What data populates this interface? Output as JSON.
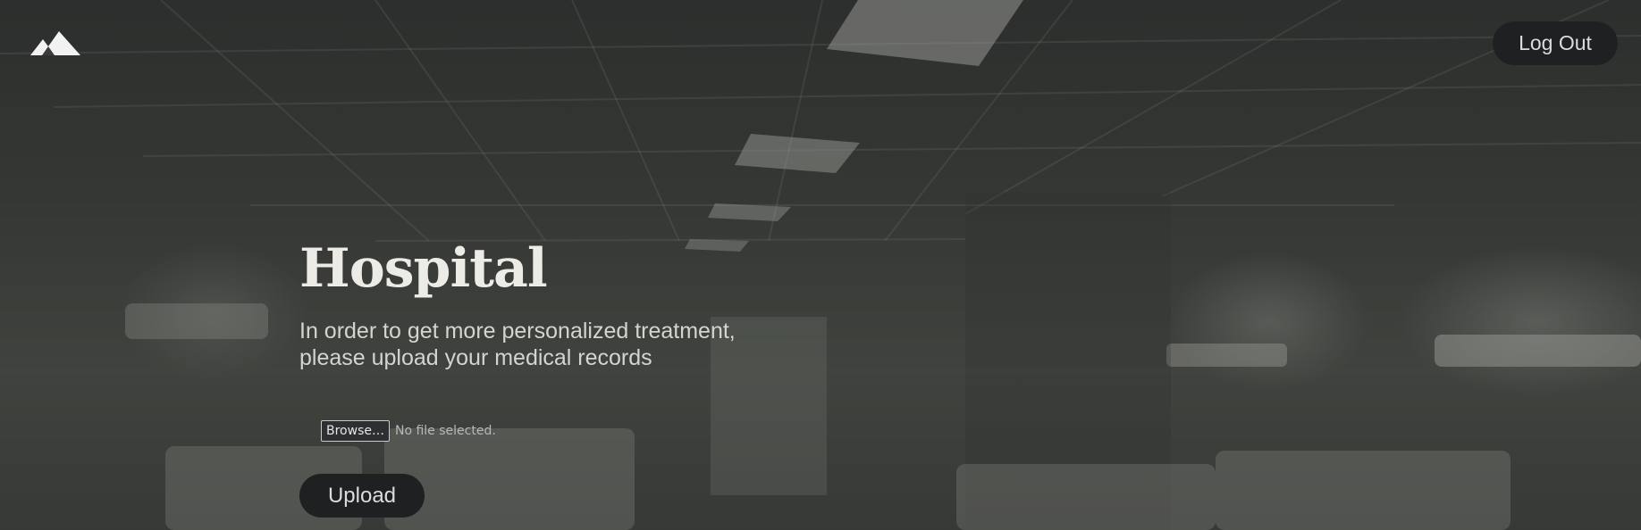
{
  "header": {
    "logo_icon": "mountain-logo-icon",
    "logout_label": "Log Out"
  },
  "hero": {
    "title": "Hospital",
    "subtitle": "In order to get more personalized treatment, please upload your medical records"
  },
  "file_input": {
    "browse_label": "Browse…",
    "status": "No file selected."
  },
  "upload_label": "Upload",
  "colors": {
    "button_bg": "#1f2022",
    "button_text": "#dcdcdc",
    "title_text": "#ecebe6"
  }
}
